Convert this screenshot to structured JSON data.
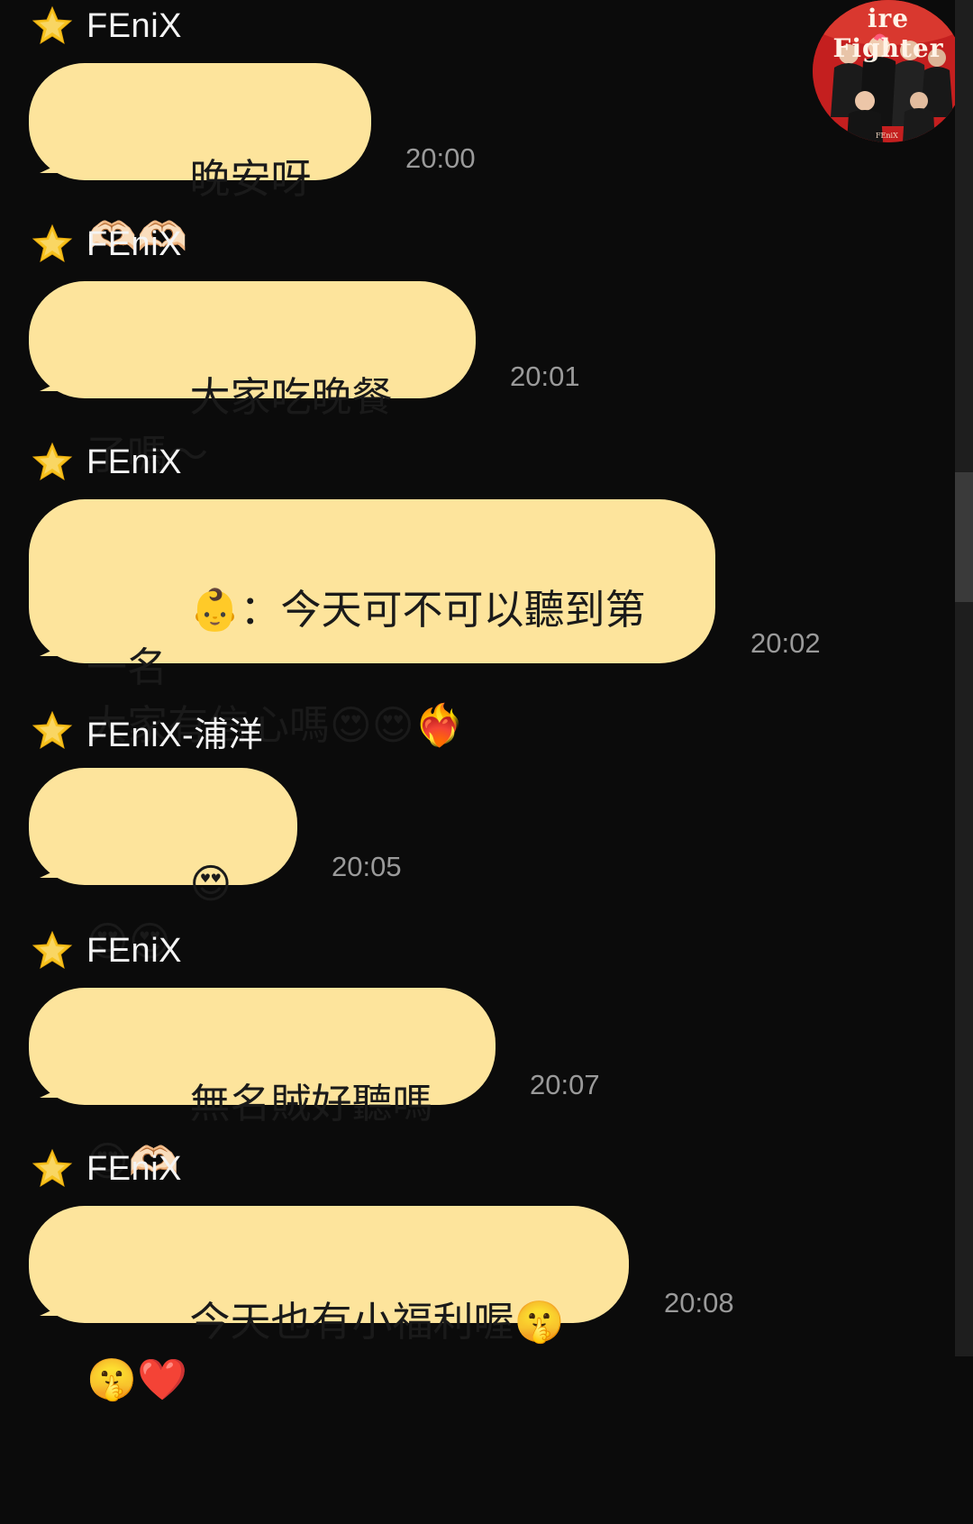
{
  "chat": {
    "avatar": {
      "caption": "ire Fighter",
      "badge": "FEniX"
    },
    "messages": [
      {
        "sender": "FEniX",
        "text": "晚安呀🫶🏻🫶🏻",
        "time": "20:00"
      },
      {
        "sender": "FEniX",
        "text": "大家吃晚餐了嗎～",
        "time": "20:01"
      },
      {
        "sender": "FEniX",
        "text": "👶：今天可不可以聽到第一名\n大家有信心嗎😍😍❤️‍🔥",
        "time": "20:02"
      },
      {
        "sender": "FEniX-浦洋",
        "text": "😍😍😍",
        "time": "20:05"
      },
      {
        "sender": "FEniX",
        "text": "無名賊好聽嗎😍🫶🏻",
        "time": "20:07"
      },
      {
        "sender": "FEniX",
        "text": "今天也有小福利喔🤫🤫❤️",
        "time": "20:08"
      }
    ]
  },
  "colors": {
    "background": "#0b0b0b",
    "bubble": "#fde49c",
    "bubble_text": "#1a1a1a",
    "sender_text": "#f4f4f4",
    "time_text": "#9a9a9a",
    "star": "#f7c21e"
  },
  "icons": {
    "sender_badge": "star-icon"
  }
}
